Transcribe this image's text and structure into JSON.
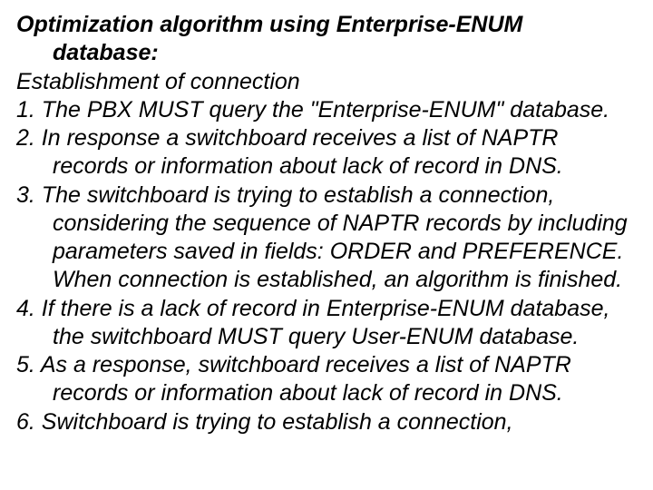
{
  "title": {
    "line1": "Optimization algorithm using Enterprise-ENUM",
    "line2": "database:"
  },
  "subheading": "Establishment of connection",
  "items": {
    "i1": "1. The PBX MUST query the \"Enterprise-ENUM\" database.",
    "i2": "2. In response a switchboard receives a list of NAPTR records or information about lack of record in DNS.",
    "i3": "3. The switchboard is trying to establish a connection, considering the sequence of NAPTR records by including parameters saved in fields: ORDER and PREFERENCE. When connection is established, an algorithm is finished.",
    "i4": "4. If there is a lack of record in Enterprise-ENUM database, the switchboard MUST query User-ENUM database.",
    "i5": "5. As a response, switchboard receives a list of NAPTR records or information about lack of record in DNS.",
    "i6": "6. Switchboard is trying to establish a connection,"
  }
}
